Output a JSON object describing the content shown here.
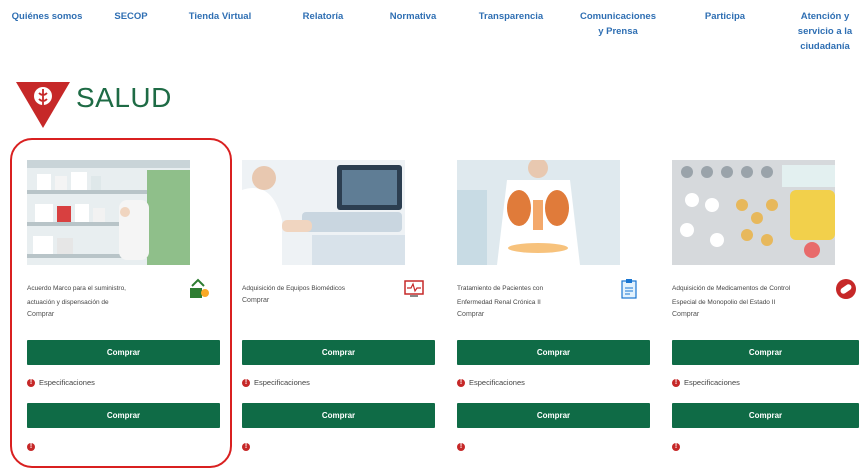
{
  "nav": [
    {
      "label": "Quiénes somos",
      "line2": ""
    },
    {
      "label": "SECOP",
      "line2": ""
    },
    {
      "label": "Tienda Virtual",
      "line2": ""
    },
    {
      "label": "Relatoría",
      "line2": ""
    },
    {
      "label": "Normativa",
      "line2": ""
    },
    {
      "label": "Transparencia",
      "line2": ""
    },
    {
      "label": "Comunicaciones",
      "line2": "y Prensa"
    },
    {
      "label": "Participa",
      "line2": ""
    },
    {
      "label": "Atención y",
      "line2": "servicio a la",
      "line3": "ciudadanía"
    }
  ],
  "section": {
    "title": "SALUD"
  },
  "cards": [
    {
      "desc1": "Acuerdo Marco para el suministro,",
      "desc2": "actuación y dispensación de",
      "buy": "Comprar",
      "btn1": "Comprar",
      "spec": "Especificaciones",
      "btn2": "Comprar",
      "icon": "pharmacy-icon"
    },
    {
      "desc1": "Adquisición de Equipos Biomédicos",
      "desc2": "",
      "buy": "Comprar",
      "btn1": "Comprar",
      "spec": "Especificaciones",
      "btn2": "Comprar",
      "icon": "monitor-icon"
    },
    {
      "desc1": "Tratamiento de Pacientes con",
      "desc2": "Enfermedad Renal Crónica II",
      "buy": "Comprar",
      "btn1": "Comprar",
      "spec": "Especificaciones",
      "btn2": "Comprar",
      "icon": "clipboard-icon"
    },
    {
      "desc1": "Adquisición de Medicamentos de Control",
      "desc2": "Especial de Monopolio del Estado II",
      "buy": "Comprar",
      "btn1": "Comprar",
      "spec": "Especificaciones",
      "btn2": "Comprar",
      "icon": "pills-icon"
    }
  ],
  "colors": {
    "nav_text": "#2f6fb3",
    "button": "#0f6b46",
    "title": "#1e6b45",
    "accent_red": "#c62828",
    "highlight": "#d92020"
  }
}
